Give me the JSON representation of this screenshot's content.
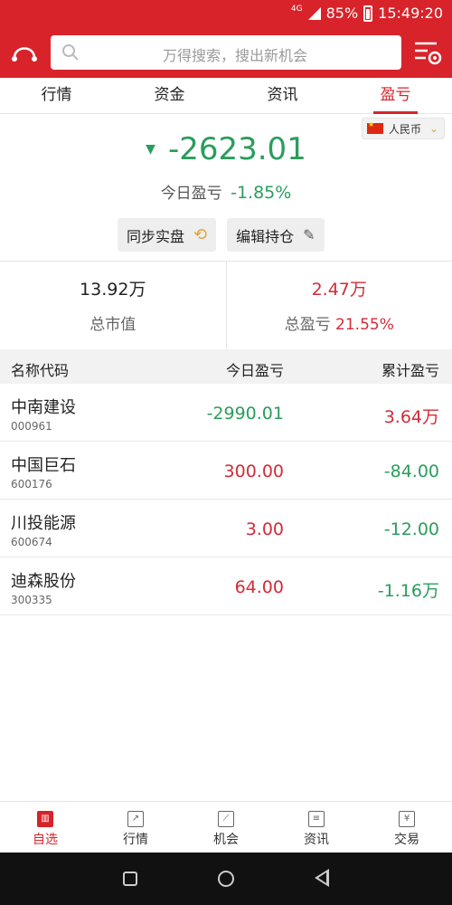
{
  "status": {
    "network": "4G",
    "battery": "85%",
    "time": "15:49:20"
  },
  "search": {
    "placeholder": "万得搜索，搜出新机会"
  },
  "tabs": [
    {
      "label": "行情"
    },
    {
      "label": "资金"
    },
    {
      "label": "资讯"
    },
    {
      "label": "盈亏",
      "active": true
    }
  ],
  "currency": {
    "label": "人民币"
  },
  "summary": {
    "pl_value": "-2623.01",
    "today_label": "今日盈亏",
    "today_pct": "-1.85%"
  },
  "actions": {
    "sync": "同步实盘",
    "edit": "编辑持仓"
  },
  "stats": {
    "market_value": "13.92万",
    "market_value_label": "总市值",
    "total_pl": "2.47万",
    "total_pl_label": "总盈亏",
    "total_pl_pct": "21.55%"
  },
  "table": {
    "headers": {
      "name": "名称代码",
      "today": "今日盈亏",
      "total": "累计盈亏"
    },
    "rows": [
      {
        "name": "中南建设",
        "code": "000961",
        "today": "-2990.01",
        "total": "3.64万"
      },
      {
        "name": "中国巨石",
        "code": "600176",
        "today": "300.00",
        "total": "-84.00"
      },
      {
        "name": "川投能源",
        "code": "600674",
        "today": "3.00",
        "total": "-12.00"
      },
      {
        "name": "迪森股份",
        "code": "300335",
        "today": "64.00",
        "total": "-1.16万"
      }
    ]
  },
  "bottom_nav": [
    {
      "label": "自选",
      "icon": "watchlist-icon",
      "active": true
    },
    {
      "label": "行情",
      "icon": "chart-icon"
    },
    {
      "label": "机会",
      "icon": "leaf-icon"
    },
    {
      "label": "资讯",
      "icon": "news-icon"
    },
    {
      "label": "交易",
      "icon": "yen-icon"
    }
  ],
  "colors": {
    "brand": "#d8232a",
    "up": "#d12c38",
    "down": "#2a9d5c"
  }
}
